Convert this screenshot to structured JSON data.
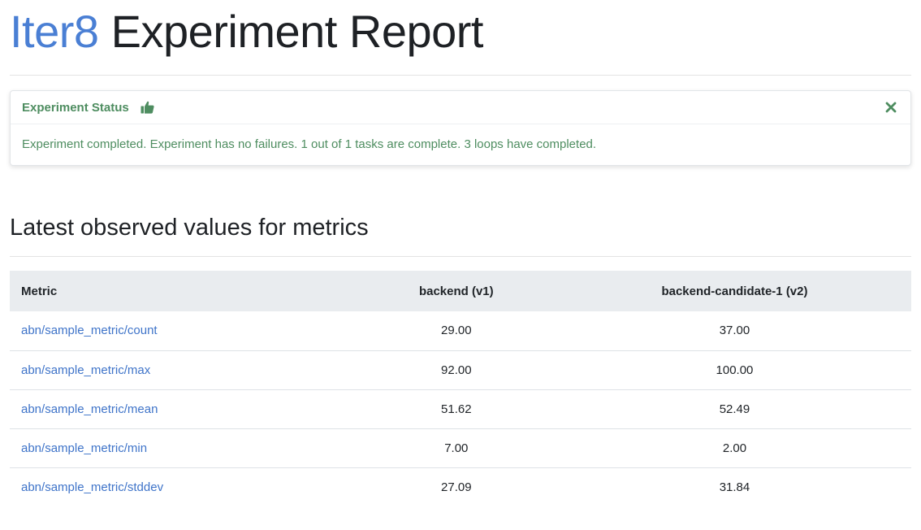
{
  "header": {
    "brand": "Iter8",
    "title_rest": " Experiment Report"
  },
  "status": {
    "title": "Experiment Status",
    "icon": "thumbs-up-icon",
    "close_icon": "close-icon",
    "message": "Experiment completed. Experiment has no failures. 1 out of 1 tasks are complete. 3 loops have completed.",
    "color": "#4e8d60"
  },
  "metrics_section": {
    "title": "Latest observed values for metrics"
  },
  "table": {
    "columns": [
      "Metric",
      "backend (v1)",
      "backend-candidate-1 (v2)"
    ],
    "rows": [
      {
        "metric": "abn/sample_metric/count",
        "v1": "29.00",
        "v2": "37.00"
      },
      {
        "metric": "abn/sample_metric/max",
        "v1": "92.00",
        "v2": "100.00"
      },
      {
        "metric": "abn/sample_metric/mean",
        "v1": "51.62",
        "v2": "52.49"
      },
      {
        "metric": "abn/sample_metric/min",
        "v1": "7.00",
        "v2": "2.00"
      },
      {
        "metric": "abn/sample_metric/stddev",
        "v1": "27.09",
        "v2": "31.84"
      }
    ]
  },
  "colors": {
    "brand": "#4a7fd4",
    "link": "#3f74c9",
    "success_text": "#4e8d60",
    "table_header_bg": "#e9ecef"
  }
}
